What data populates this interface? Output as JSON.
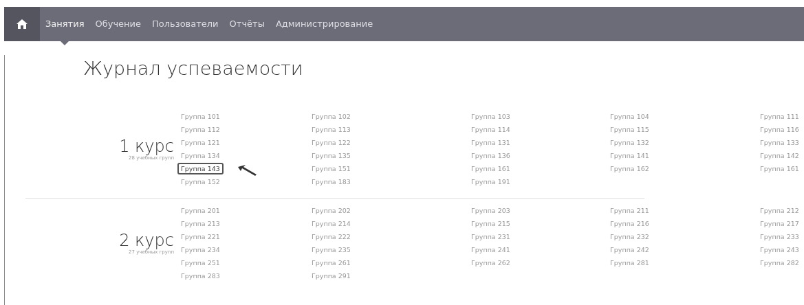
{
  "navbar": {
    "items": [
      {
        "label": "Занятия",
        "selected": true
      },
      {
        "label": "Обучение",
        "selected": false
      },
      {
        "label": "Пользователи",
        "selected": false
      },
      {
        "label": "Отчёты",
        "selected": false
      },
      {
        "label": "Администрирование",
        "selected": false
      }
    ]
  },
  "page_title": "Журнал успеваемости",
  "courses": [
    {
      "title": "1 курс",
      "subtitle": "28 учебных групп",
      "groups": [
        {
          "label": "Группа 101",
          "selected": false
        },
        {
          "label": "Группа 102",
          "selected": false
        },
        {
          "label": "Группа 103",
          "selected": false
        },
        {
          "label": "Группа 104",
          "selected": false
        },
        {
          "label": "Группа 111",
          "selected": false
        },
        {
          "label": "Группа 112",
          "selected": false
        },
        {
          "label": "Группа 113",
          "selected": false
        },
        {
          "label": "Группа 114",
          "selected": false
        },
        {
          "label": "Группа 115",
          "selected": false
        },
        {
          "label": "Группа 116",
          "selected": false
        },
        {
          "label": "Группа 121",
          "selected": false
        },
        {
          "label": "Группа 122",
          "selected": false
        },
        {
          "label": "Группа 131",
          "selected": false
        },
        {
          "label": "Группа 132",
          "selected": false
        },
        {
          "label": "Группа 133",
          "selected": false
        },
        {
          "label": "Группа 134",
          "selected": false
        },
        {
          "label": "Группа 135",
          "selected": false
        },
        {
          "label": "Группа 136",
          "selected": false
        },
        {
          "label": "Группа 141",
          "selected": false
        },
        {
          "label": "Группа 142",
          "selected": false
        },
        {
          "label": "Группа 143",
          "selected": true
        },
        {
          "label": "Группа 151",
          "selected": false
        },
        {
          "label": "Группа 161",
          "selected": false
        },
        {
          "label": "Группа 162",
          "selected": false
        },
        {
          "label": "Группа 161",
          "selected": false
        },
        {
          "label": "Группа 152",
          "selected": false
        },
        {
          "label": "Группа 183",
          "selected": false
        },
        {
          "label": "Группа 191",
          "selected": false
        }
      ]
    },
    {
      "title": "2 курс",
      "subtitle": "27 учебных групп",
      "groups": [
        {
          "label": "Группа 201",
          "selected": false
        },
        {
          "label": "Группа 202",
          "selected": false
        },
        {
          "label": "Группа 203",
          "selected": false
        },
        {
          "label": "Группа 211",
          "selected": false
        },
        {
          "label": "Группа 212",
          "selected": false
        },
        {
          "label": "Группа 213",
          "selected": false
        },
        {
          "label": "Группа 214",
          "selected": false
        },
        {
          "label": "Группа 215",
          "selected": false
        },
        {
          "label": "Группа 216",
          "selected": false
        },
        {
          "label": "Группа 217",
          "selected": false
        },
        {
          "label": "Группа 221",
          "selected": false
        },
        {
          "label": "Группа 222",
          "selected": false
        },
        {
          "label": "Группа 231",
          "selected": false
        },
        {
          "label": "Группа 232",
          "selected": false
        },
        {
          "label": "Группа 233",
          "selected": false
        },
        {
          "label": "Группа 234",
          "selected": false
        },
        {
          "label": "Группа 235",
          "selected": false
        },
        {
          "label": "Группа 241",
          "selected": false
        },
        {
          "label": "Группа 242",
          "selected": false
        },
        {
          "label": "Группа 243",
          "selected": false
        },
        {
          "label": "Группа 251",
          "selected": false
        },
        {
          "label": "Группа 261",
          "selected": false
        },
        {
          "label": "Группа 262",
          "selected": false
        },
        {
          "label": "Группа 281",
          "selected": false
        },
        {
          "label": "Группа 282",
          "selected": false
        },
        {
          "label": "Группа 283",
          "selected": false
        },
        {
          "label": "Группа 291",
          "selected": false
        }
      ]
    }
  ]
}
